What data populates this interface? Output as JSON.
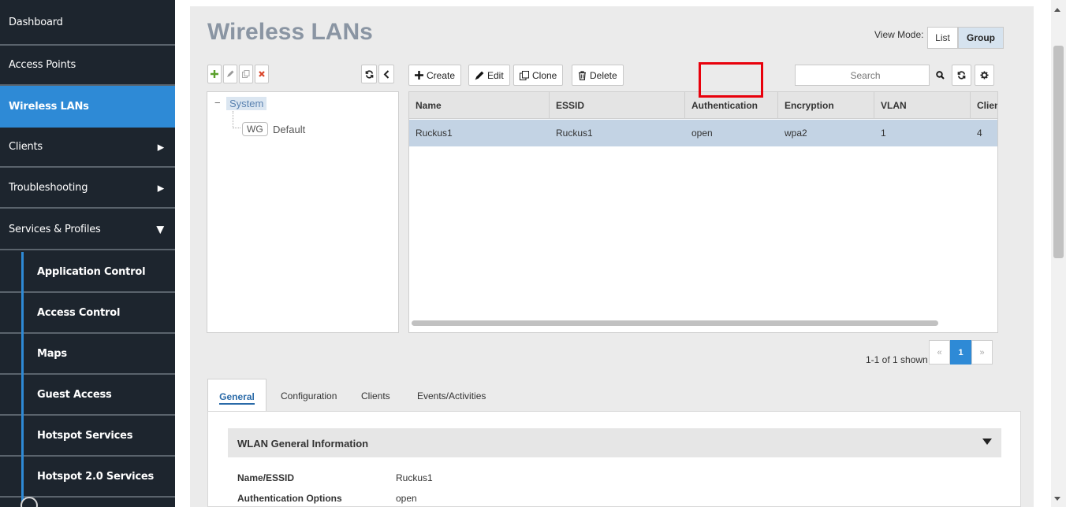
{
  "sidebar": {
    "items": [
      {
        "label": "Dashboard"
      },
      {
        "label": "Access Points"
      },
      {
        "label": "Wireless LANs"
      },
      {
        "label": "Clients"
      },
      {
        "label": "Troubleshooting"
      },
      {
        "label": "Services & Profiles"
      },
      {
        "label": "Application Control"
      },
      {
        "label": "Access Control"
      },
      {
        "label": "Maps"
      },
      {
        "label": "Guest Access"
      },
      {
        "label": "Hotspot Services"
      },
      {
        "label": "Hotspot 2.0 Services"
      }
    ],
    "arrow_right": "▶",
    "arrow_down": "▼"
  },
  "header": {
    "title": "Wireless LANs",
    "view_mode_label": "View Mode:",
    "view_modes": [
      "List",
      "Group"
    ],
    "selected_view_mode": "Group"
  },
  "toolbar": {
    "create_label": "Create",
    "edit_label": "Edit",
    "clone_label": "Clone",
    "delete_label": "Delete",
    "search_placeholder": "Search"
  },
  "tree": {
    "root": "System",
    "collapse_glyph": "−",
    "child_badge": "WG",
    "child_label": "Default"
  },
  "grid": {
    "columns": [
      "Name",
      "ESSID",
      "Authentication",
      "Encryption",
      "VLAN",
      "Clien"
    ],
    "rows": [
      [
        "Ruckus1",
        "Ruckus1",
        "open",
        "wpa2",
        "1",
        "4"
      ]
    ]
  },
  "pager": {
    "summary": "1-1 of 1 shown",
    "prev": "«",
    "current": "1",
    "next": "»"
  },
  "tabs": [
    "General",
    "Configuration",
    "Clients",
    "Events/Activities"
  ],
  "details": {
    "section_title": "WLAN General Information",
    "fields": [
      {
        "label": "Name/ESSID",
        "value": "Ruckus1"
      },
      {
        "label": "Authentication Options",
        "value": "open"
      }
    ]
  },
  "colors": {
    "sidebar_bg": "#1d252e",
    "accent": "#2e8ad6",
    "highlight_box": "#e8000b"
  }
}
